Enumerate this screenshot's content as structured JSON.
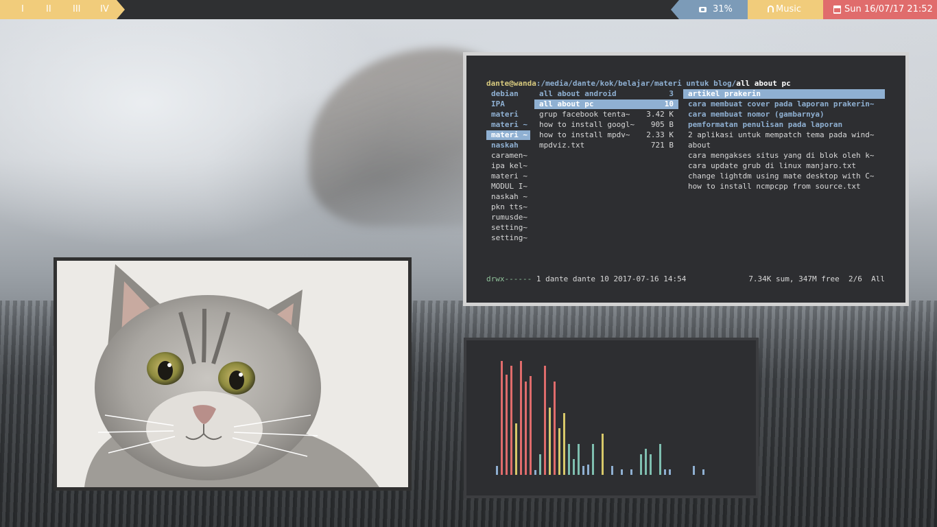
{
  "topbar": {
    "workspaces": [
      "I",
      "II",
      "III",
      "IV"
    ],
    "battery": "31%",
    "music": "Music",
    "datetime": "Sun 16/07/17 21:52",
    "colors": {
      "workspace_bg": "#f1cc7b",
      "battery_bg": "#7c9bb8",
      "music_bg": "#f1cc7b",
      "date_bg": "#e06c6c"
    }
  },
  "terminal": {
    "prompt": {
      "user": "dante@wanda",
      "path": ":/media/dante/kok/belajar/materi untuk blog/",
      "current": "all about pc"
    },
    "parent_column": [
      {
        "name": "debian",
        "kind": "dir"
      },
      {
        "name": "IPA",
        "kind": "dir"
      },
      {
        "name": "materi",
        "kind": "dir"
      },
      {
        "name": "materi ~",
        "kind": "dir"
      },
      {
        "name": "materi ~",
        "kind": "selected"
      },
      {
        "name": "naskah",
        "kind": "dir"
      },
      {
        "name": "caramen~",
        "kind": "file"
      },
      {
        "name": "ipa kel~",
        "kind": "file"
      },
      {
        "name": "materi ~",
        "kind": "file"
      },
      {
        "name": "MODUL I~",
        "kind": "file"
      },
      {
        "name": "naskah ~",
        "kind": "file"
      },
      {
        "name": "pkn tts~",
        "kind": "file"
      },
      {
        "name": "rumusde~",
        "kind": "file"
      },
      {
        "name": "setting~",
        "kind": "file"
      },
      {
        "name": "setting~",
        "kind": "file"
      }
    ],
    "current_column": [
      {
        "name": "all about android",
        "size": "3",
        "kind": "dir"
      },
      {
        "name": "all about pc",
        "size": "10",
        "kind": "selected"
      },
      {
        "name": "grup facebook tenta~",
        "size": "3.42 K",
        "kind": "file"
      },
      {
        "name": "how to install googl~",
        "size": "905 B",
        "kind": "file"
      },
      {
        "name": "how to install mpdv~",
        "size": "2.33 K",
        "kind": "file"
      },
      {
        "name": "mpdviz.txt",
        "size": "721 B",
        "kind": "file"
      }
    ],
    "preview_column": [
      {
        "name": "artikel prakerin",
        "kind": "selected"
      },
      {
        "name": "cara membuat cover pada laporan prakerin~",
        "kind": "dir"
      },
      {
        "name": "cara membuat nomor (gambarnya)",
        "kind": "dir"
      },
      {
        "name": "pemformatan penulisan pada laporan",
        "kind": "dir"
      },
      {
        "name": "2 aplikasi untuk mempatch tema pada wind~",
        "kind": "file"
      },
      {
        "name": "about",
        "kind": "file"
      },
      {
        "name": "cara mengakses situs yang di blok oleh k~",
        "kind": "file"
      },
      {
        "name": "cara update grub di linux manjaro.txt",
        "kind": "file"
      },
      {
        "name": "change lightdm using mate desktop with C~",
        "kind": "file"
      },
      {
        "name": "how to install ncmpcpp from source.txt",
        "kind": "file"
      }
    ],
    "status": {
      "permissions": "drwx------",
      "info": " 1 dante dante 10 2017-07-16 14:54",
      "summary": "7.34K sum, 347M free  2/6  All"
    }
  },
  "visualizer": {
    "colors": {
      "red": "#e06c6c",
      "yellow": "#d8c96a",
      "teal": "#7fbfb0",
      "blue": "#8fb0d2"
    },
    "levels": [
      {
        "v": 0.08,
        "c": "blue"
      },
      {
        "v": 1.0,
        "c": "red"
      },
      {
        "v": 0.88,
        "c": "red"
      },
      {
        "v": 0.96,
        "c": "red"
      },
      {
        "v": 0.45,
        "c": "yellow"
      },
      {
        "v": 1.0,
        "c": "red"
      },
      {
        "v": 0.82,
        "c": "red"
      },
      {
        "v": 0.87,
        "c": "red"
      },
      {
        "v": 0.04,
        "c": "blue"
      },
      {
        "v": 0.18,
        "c": "teal"
      },
      {
        "v": 0.96,
        "c": "red"
      },
      {
        "v": 0.59,
        "c": "yellow"
      },
      {
        "v": 0.82,
        "c": "red"
      },
      {
        "v": 0.41,
        "c": "yellow"
      },
      {
        "v": 0.54,
        "c": "yellow"
      },
      {
        "v": 0.27,
        "c": "teal"
      },
      {
        "v": 0.14,
        "c": "teal"
      },
      {
        "v": 0.27,
        "c": "teal"
      },
      {
        "v": 0.08,
        "c": "blue"
      },
      {
        "v": 0.09,
        "c": "blue"
      },
      {
        "v": 0.27,
        "c": "teal"
      },
      {
        "v": 0,
        "c": "teal"
      },
      {
        "v": 0.36,
        "c": "yellow"
      },
      {
        "v": 0,
        "c": "teal"
      },
      {
        "v": 0.08,
        "c": "blue"
      },
      {
        "v": 0,
        "c": "teal"
      },
      {
        "v": 0.05,
        "c": "blue"
      },
      {
        "v": 0,
        "c": "teal"
      },
      {
        "v": 0.05,
        "c": "blue"
      },
      {
        "v": 0,
        "c": "teal"
      },
      {
        "v": 0.18,
        "c": "teal"
      },
      {
        "v": 0.23,
        "c": "teal"
      },
      {
        "v": 0.18,
        "c": "teal"
      },
      {
        "v": 0,
        "c": "teal"
      },
      {
        "v": 0.27,
        "c": "teal"
      },
      {
        "v": 0.05,
        "c": "blue"
      },
      {
        "v": 0.05,
        "c": "blue"
      },
      {
        "v": 0,
        "c": "teal"
      },
      {
        "v": 0,
        "c": "teal"
      },
      {
        "v": 0,
        "c": "teal"
      },
      {
        "v": 0,
        "c": "teal"
      },
      {
        "v": 0.08,
        "c": "blue"
      },
      {
        "v": 0,
        "c": "teal"
      },
      {
        "v": 0.05,
        "c": "blue"
      }
    ]
  }
}
